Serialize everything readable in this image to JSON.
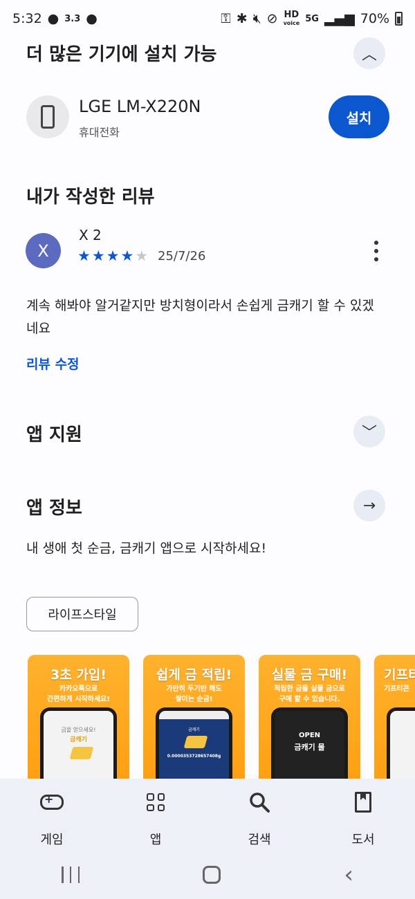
{
  "status_bar": {
    "time": "5:32",
    "net_speed": "3.3",
    "network": "5G",
    "hd_label": "HD",
    "hd_sub": "voice",
    "battery": "70%"
  },
  "install_section": {
    "title": "더 많은 기기에 설치 가능",
    "device_name": "LGE LM-X220N",
    "device_type": "휴대전화",
    "install_label": "설치"
  },
  "review_section": {
    "title": "내가 작성한 리뷰",
    "avatar_initial": "X",
    "reviewer_name": "X 2",
    "rating": 4,
    "max_rating": 5,
    "date": "25/7/26",
    "text": "계속 해봐야 알거같지만 방치형이라서 손쉽게 금캐기 할 수 있겠네요",
    "edit_label": "리뷰 수정"
  },
  "support_section": {
    "title": "앱 지원"
  },
  "info_section": {
    "title": "앱 정보",
    "description": "내 생애 첫 순금, 금캐기 앱으로 시작하세요!",
    "category_chip": "라이프스타일"
  },
  "screenshots": [
    {
      "title": "3초 가입!",
      "subtitle": "카카오톡으로\n간편하게 시작하세요!",
      "screen_text_1": "금을 얻으세요!",
      "screen_text_2": "금캐기"
    },
    {
      "title": "쉽게 금 적립!",
      "subtitle": "가만히 두기만 해도\n쌓이는 순금!",
      "screen_text_1": "0.0000353728657408g",
      "screen_text_2": "금캐기"
    },
    {
      "title": "실물 금 구매!",
      "subtitle": "적립한 금을 실물 금으로\n구매 할 수 있습니다.",
      "screen_text_1": "OPEN",
      "screen_text_2": "금캐기 몰"
    },
    {
      "title": "기프티",
      "subtitle": "기프티콘",
      "screen_text_1": "",
      "screen_text_2": ""
    }
  ],
  "bottom_nav": [
    {
      "label": "게임",
      "icon": "gamepad-icon"
    },
    {
      "label": "앱",
      "icon": "apps-grid-icon"
    },
    {
      "label": "검색",
      "icon": "search-icon"
    },
    {
      "label": "도서",
      "icon": "book-icon"
    }
  ],
  "colors": {
    "accent": "#0b57d0",
    "avatar": "#5c6bc0",
    "screenshot_bg": "#ffa51f",
    "nav_bg": "#eef0f7"
  }
}
